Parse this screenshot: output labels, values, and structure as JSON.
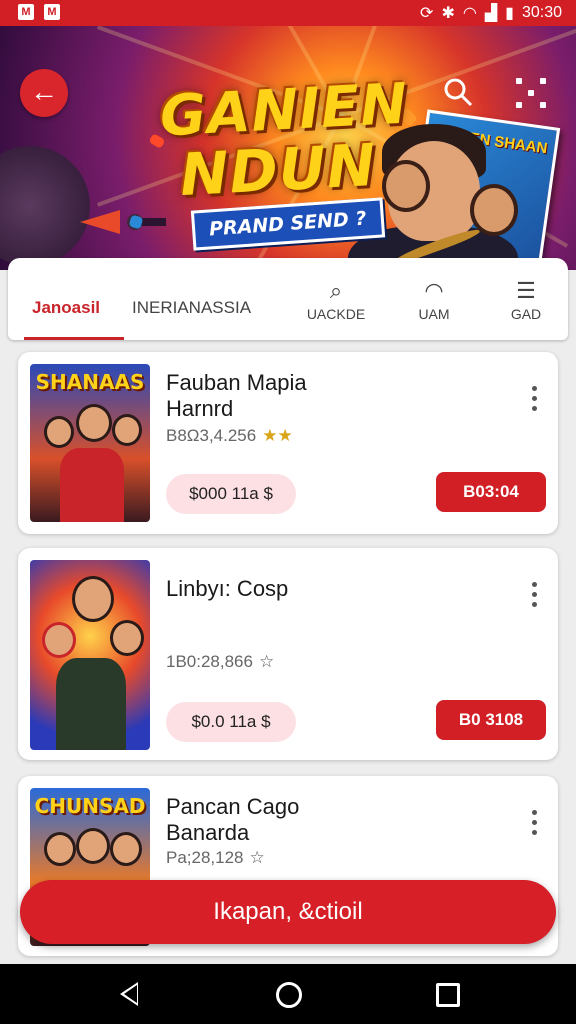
{
  "status_bar": {
    "time": "30:30",
    "left_icons": [
      "M",
      "M"
    ]
  },
  "hero": {
    "title_line1": "GANIEN",
    "title_line2": "NDUN",
    "subtitle": "PRAND SEND ?",
    "book_title": "SUIBEN SHAAN"
  },
  "tabs": [
    {
      "label": "Janoasil",
      "active": true
    },
    {
      "label": "INERIANASSIA"
    },
    {
      "label": "UACKDE",
      "icon": "search-pin-icon"
    },
    {
      "label": "UAM",
      "icon": "headset-icon"
    },
    {
      "label": "GAD",
      "icon": "list-icon"
    }
  ],
  "cards": [
    {
      "thumb_title": "SHANAAS",
      "name_line1": "Fauban Mapia",
      "name_line2": "Harnrd",
      "meta": "B8Ω3,4.256",
      "stars": "★★",
      "price": "$000 11a $",
      "buy": "B03:04"
    },
    {
      "thumb_title": "",
      "name_line1": "Linbyı: Cosp",
      "name_line2": "",
      "meta": "1B0:28,866",
      "stars": "☆",
      "price": "$0.0 11a $",
      "buy": "B0 3108"
    },
    {
      "thumb_title": "CHUNSAD",
      "name_line1": "Pancan Cago",
      "name_line2": "Banarda",
      "meta": "Pa;28,128",
      "stars": "☆"
    }
  ],
  "fab": {
    "label": "Ikapan, &ctioil"
  },
  "colors": {
    "accent": "#d21f26",
    "pill": "#fde0e4"
  }
}
